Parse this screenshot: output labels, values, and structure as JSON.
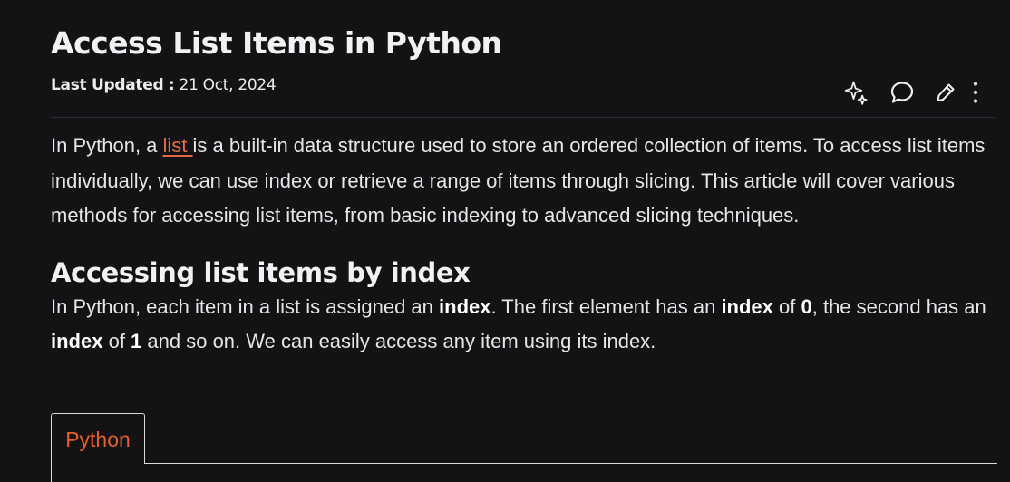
{
  "article": {
    "title": "Access List Items in Python",
    "updated_label": "Last Updated :",
    "updated_date": "21 Oct, 2024"
  },
  "toolbar": {
    "icons": [
      "sparkle-icon",
      "comment-icon",
      "pencil-icon",
      "more-vertical-icon"
    ]
  },
  "intro": {
    "before_link": "In Python, a ",
    "link_text": "list ",
    "after_link": "is a built-in data structure used to store an ordered collection of items. To access list items individually, we can use index or retrieve a range of items through slicing. This article will cover various methods for accessing list items, from basic indexing to advanced slicing techniques."
  },
  "section": {
    "heading": "Accessing list items by index",
    "p1": "In Python, each item in a list is assigned an ",
    "b1": "index",
    "p2": ". The first element has an ",
    "b2": "index",
    "p3": " of ",
    "b3": "0",
    "p4": ", the second has an ",
    "b4": "index",
    "p5": " of ",
    "b5": "1",
    "p6": " and so on. We can easily access any item using its index."
  },
  "code": {
    "tab_label": "Python"
  },
  "colors": {
    "background": "#131316",
    "link": "#e66b45",
    "tab_text": "#e85d2c"
  }
}
